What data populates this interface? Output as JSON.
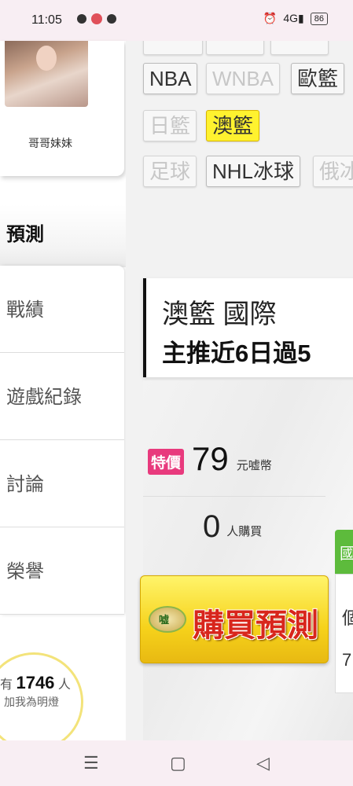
{
  "status_bar": {
    "time": "11:05",
    "signal_text": "4G",
    "battery": "86",
    "icons": [
      "chat-icon",
      "notification-badge-icon",
      "line-app-icon",
      "alarm-icon",
      "volte-icon",
      "signal-icon",
      "battery-icon"
    ]
  },
  "profile": {
    "name": "哥哥妹妹"
  },
  "sidebar": {
    "active_tab": "預測",
    "items": [
      {
        "label": "戰績"
      },
      {
        "label": "遊戲紀錄"
      },
      {
        "label": "討論"
      },
      {
        "label": "榮譽"
      }
    ],
    "fans": {
      "prefix": "有",
      "count": "1746",
      "suffix": "人",
      "caption": "加我為明燈"
    }
  },
  "categories": {
    "row1": [
      "NBA",
      "WNBA",
      "歐籃"
    ],
    "row2": [
      "日籃",
      "澳籃"
    ],
    "row3": [
      "足球",
      "NHL冰球",
      "俄冰"
    ],
    "active": "澳籃",
    "dimmed": [
      "WNBA",
      "日籃",
      "足球",
      "俄冰"
    ]
  },
  "prediction_card": {
    "league": "澳籃 國際",
    "headline": "主推近6日過5"
  },
  "offer": {
    "badge": "特價",
    "price": "79",
    "price_unit": "元嘘幣",
    "buyers": "0",
    "buyers_unit": "人購買",
    "coin_label": "嘘",
    "buy_button": "購買預測",
    "side_chars": [
      "國",
      "個",
      "7"
    ]
  },
  "colors": {
    "active_chip": "#fff22f",
    "badge": "#e83a7d",
    "buy_text": "#d8261c",
    "green_tab": "#5dbb3c"
  }
}
